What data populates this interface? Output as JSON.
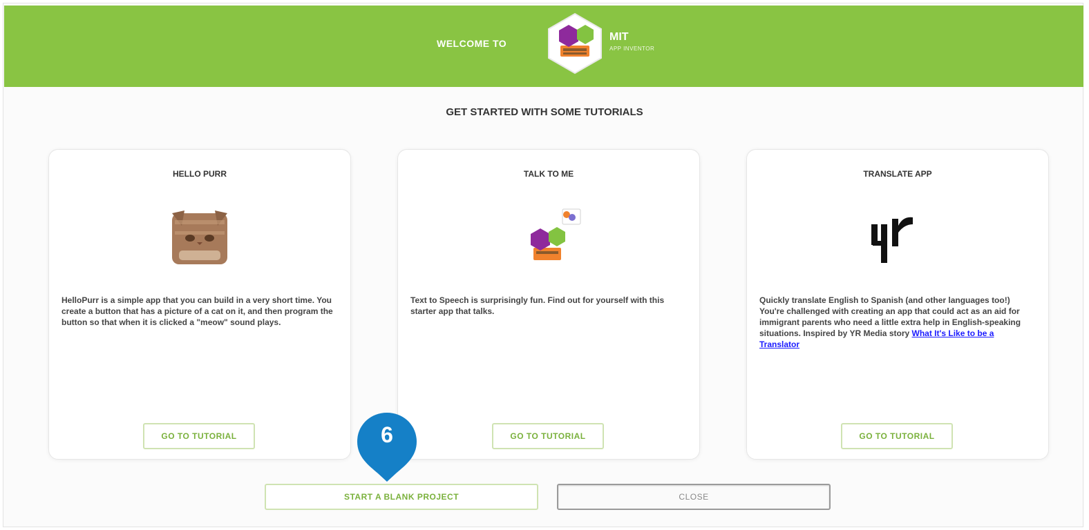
{
  "header": {
    "welcome": "WELCOME TO",
    "logo_title": "MIT",
    "logo_subtitle": "APP INVENTOR"
  },
  "heading": "GET STARTED WITH SOME TUTORIALS",
  "tutorials": [
    {
      "title": "HELLO PURR",
      "description": "HelloPurr is a simple app that you can build in a very short time. You create a button that has a picture of a cat on it, and then program the button so that when it is clicked a \"meow\" sound plays.",
      "button": "GO TO TUTORIAL",
      "image": "cat-image"
    },
    {
      "title": "TALK TO ME",
      "description": "Text to Speech is surprisingly fun. Find out for yourself with this starter app that talks.",
      "button": "GO TO TUTORIAL",
      "image": "talk-to-me-image"
    },
    {
      "title": "TRANSLATE APP",
      "description": "Quickly translate English to Spanish (and other languages too!) You're challenged with creating an app that could act as an aid for immigrant parents who need a little extra help in English-speaking situations. Inspired by YR Media story",
      "link": "What It's Like to be a Translator",
      "button": "GO TO TUTORIAL",
      "image": "yr-logo-image"
    }
  ],
  "actions": {
    "blank_project": "START A BLANK PROJECT",
    "close": "CLOSE"
  },
  "callout": {
    "number": "6"
  },
  "colors": {
    "banner": "#89c443",
    "button_border": "#cfe3b2",
    "button_text": "#7ab13c",
    "callout": "#1580c7"
  }
}
